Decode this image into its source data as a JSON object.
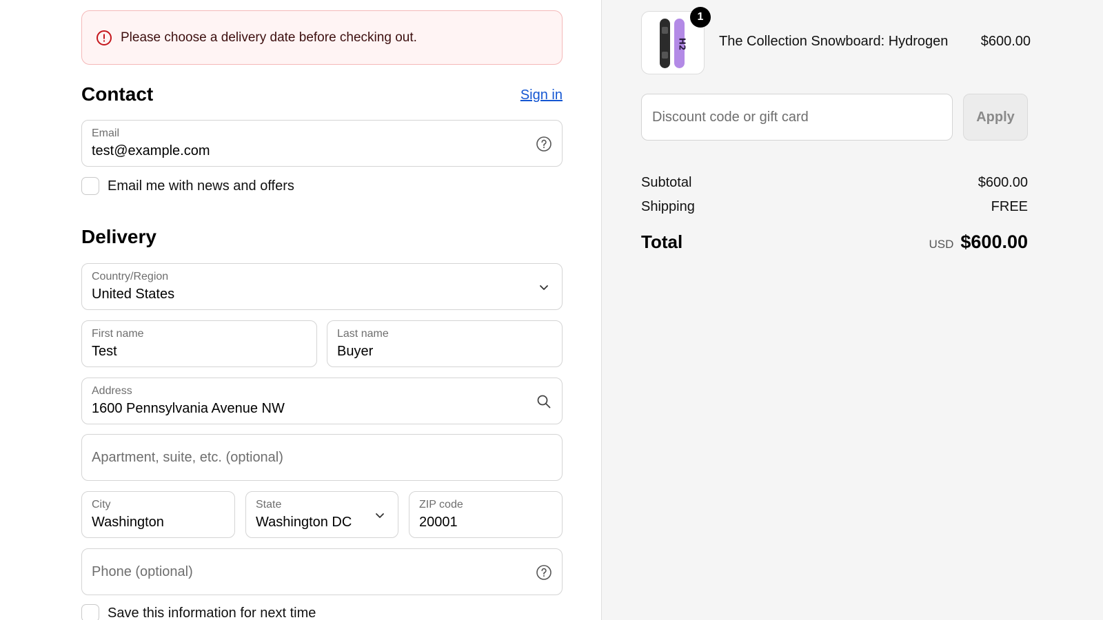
{
  "alert": {
    "message": "Please choose a delivery date before checking out."
  },
  "contact": {
    "heading": "Contact",
    "sign_in": "Sign in",
    "email": {
      "label": "Email",
      "value": "test@example.com"
    },
    "news_checkbox": {
      "label": "Email me with news and offers",
      "checked": false
    }
  },
  "delivery": {
    "heading": "Delivery",
    "country": {
      "label": "Country/Region",
      "value": "United States"
    },
    "first_name": {
      "label": "First name",
      "value": "Test"
    },
    "last_name": {
      "label": "Last name",
      "value": "Buyer"
    },
    "address": {
      "label": "Address",
      "value": "1600 Pennsylvania Avenue NW"
    },
    "apartment": {
      "placeholder": "Apartment, suite, etc. (optional)"
    },
    "city": {
      "label": "City",
      "value": "Washington"
    },
    "state": {
      "label": "State",
      "value": "Washington DC"
    },
    "zip": {
      "label": "ZIP code",
      "value": "20001"
    },
    "phone": {
      "placeholder": "Phone (optional)"
    },
    "save_checkbox": {
      "label": "Save this information for next time",
      "checked": false
    }
  },
  "summary": {
    "product": {
      "name": "The Collection Snowboard: Hydrogen",
      "price": "$600.00",
      "quantity": "1",
      "board_text": "H2"
    },
    "discount": {
      "placeholder": "Discount code or gift card",
      "apply_label": "Apply"
    },
    "subtotal": {
      "label": "Subtotal",
      "value": "$600.00"
    },
    "shipping": {
      "label": "Shipping",
      "value": "FREE"
    },
    "total": {
      "label": "Total",
      "currency": "USD",
      "value": "$600.00"
    }
  },
  "colors": {
    "link": "#1456d2",
    "alert_bg": "#fff4f4",
    "alert_border": "#f4b8b8",
    "error_icon": "#c4161c"
  },
  "icons": [
    "error-icon",
    "help-icon",
    "chevron-down-icon",
    "search-icon"
  ]
}
